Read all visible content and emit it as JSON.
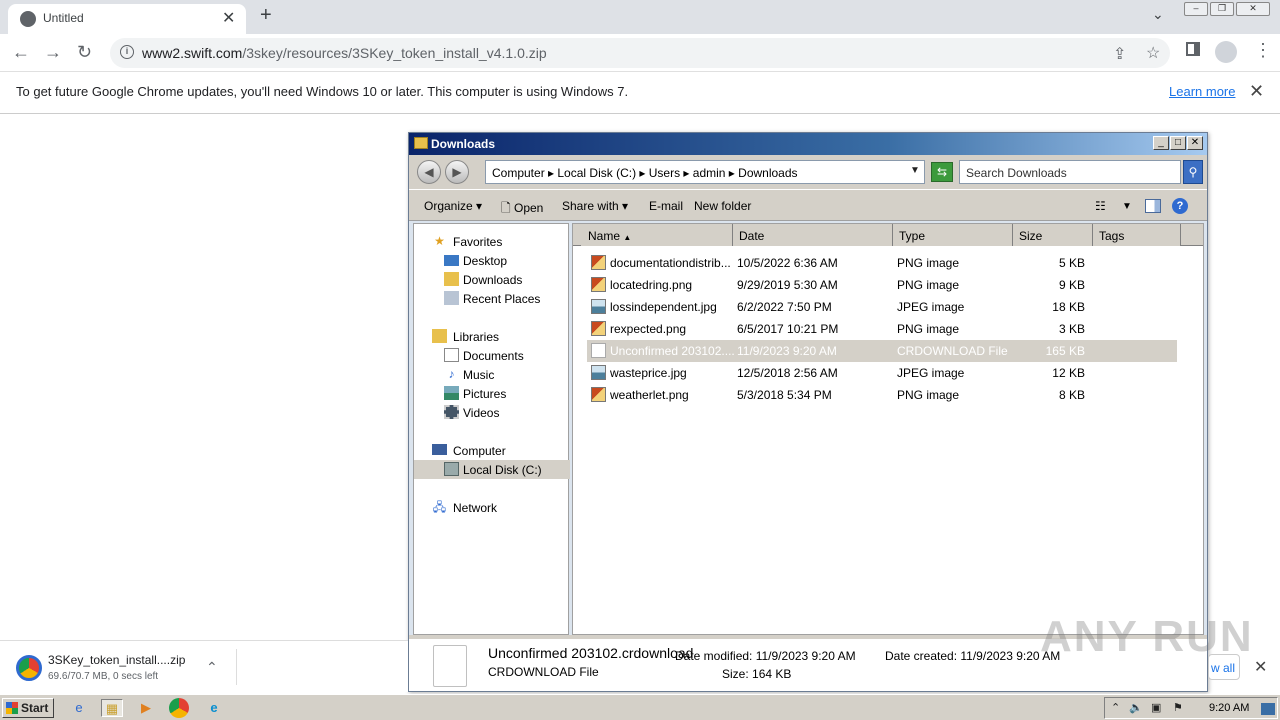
{
  "browser": {
    "tab_title": "Untitled",
    "tab_close": "✕",
    "new_tab": "+",
    "url_host": "www2.swift.com",
    "url_path": "/3skey/resources/3SKey_token_install_v4.1.0.zip",
    "infobar_message": "To get future Google Chrome updates, you'll need Windows 10 or later. This computer is using Windows 7.",
    "infobar_link": "Learn more"
  },
  "explorer": {
    "title": "Downloads",
    "breadcrumbs": "Computer  ▸  Local Disk (C:)  ▸  Users  ▸  admin  ▸  Downloads",
    "search_placeholder": "Search Downloads",
    "commands": {
      "organize": "Organize",
      "open": "Open",
      "share_with": "Share with",
      "email": "E-mail",
      "new_folder": "New folder"
    },
    "nav": {
      "favorites": "Favorites",
      "desktop": "Desktop",
      "downloads": "Downloads",
      "recent": "Recent Places",
      "libraries": "Libraries",
      "documents": "Documents",
      "music": "Music",
      "pictures": "Pictures",
      "videos": "Videos",
      "computer": "Computer",
      "local_disk": "Local Disk (C:)",
      "network": "Network"
    },
    "columns": {
      "name": "Name",
      "date": "Date",
      "type": "Type",
      "size": "Size",
      "tags": "Tags"
    },
    "files": [
      {
        "name": "documentationdistrib...",
        "date": "10/5/2022 6:36 AM",
        "type": "PNG image",
        "size": "5 KB"
      },
      {
        "name": "locatedring.png",
        "date": "9/29/2019 5:30 AM",
        "type": "PNG image",
        "size": "9 KB"
      },
      {
        "name": "lossindependent.jpg",
        "date": "6/2/2022 7:50 PM",
        "type": "JPEG image",
        "size": "18 KB"
      },
      {
        "name": "rexpected.png",
        "date": "6/5/2017 10:21 PM",
        "type": "PNG image",
        "size": "3 KB"
      },
      {
        "name": "Unconfirmed 203102....",
        "date": "11/9/2023 9:20 AM",
        "type": "CRDOWNLOAD File",
        "size": "165 KB"
      },
      {
        "name": "wasteprice.jpg",
        "date": "12/5/2018 2:56 AM",
        "type": "JPEG image",
        "size": "12 KB"
      },
      {
        "name": "weatherlet.png",
        "date": "5/3/2018 5:34 PM",
        "type": "PNG image",
        "size": "8 KB"
      }
    ],
    "details": {
      "filename": "Unconfirmed 203102.crdownload",
      "filetype": "CRDOWNLOAD File",
      "modified_label": "Date modified:",
      "modified_value": "11/9/2023 9:20 AM",
      "size_label": "Size:",
      "size_value": "164 KB",
      "created_label": "Date created:",
      "created_value": "11/9/2023 9:20 AM"
    }
  },
  "download": {
    "filename": "3SKey_token_install....zip",
    "status": "69.6/70.7 MB, 0 secs left",
    "show_all": "w all"
  },
  "watermark": "ANY RUN",
  "taskbar": {
    "start": "Start",
    "clock": "9:20 AM"
  }
}
